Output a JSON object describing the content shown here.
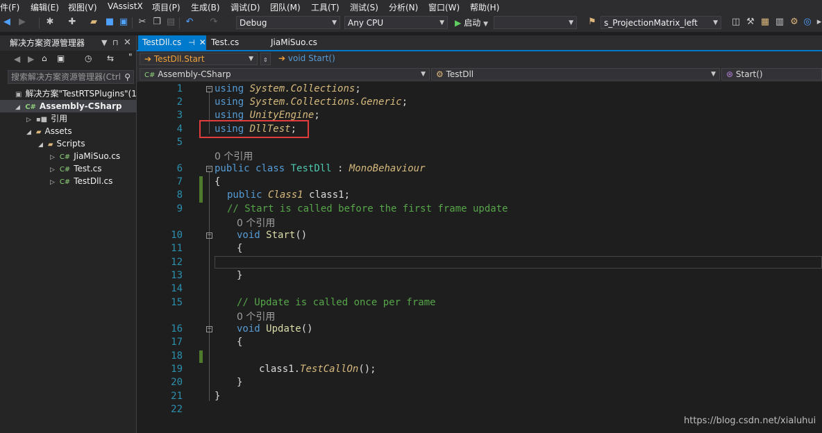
{
  "menu": [
    "件(F)",
    "编辑(E)",
    "视图(V)",
    "VAssistX",
    "项目(P)",
    "生成(B)",
    "调试(D)",
    "团队(M)",
    "工具(T)",
    "测试(S)",
    "分析(N)",
    "窗口(W)",
    "帮助(H)"
  ],
  "toolbar": {
    "config": "Debug",
    "platform": "Any CPU",
    "start_label": "启动",
    "target": "s_ProjectionMatrix_left"
  },
  "solution_explorer": {
    "title": "解决方案资源管理器",
    "search_placeholder": "搜索解决方案资源管理器(Ctrl",
    "tree": [
      {
        "label": "解决方案\"TestRTSPlugins\"(1 ·",
        "icon": "solution-icon"
      },
      {
        "label": "Assembly-CSharp",
        "icon": "csharp-project-icon"
      },
      {
        "label": "引用",
        "icon": "references-icon"
      },
      {
        "label": "Assets",
        "icon": "folder-icon"
      },
      {
        "label": "Scripts",
        "icon": "folder-icon"
      },
      {
        "label": "JiaMiSuo.cs",
        "icon": "csharp-file-icon"
      },
      {
        "label": "Test.cs",
        "icon": "csharp-file-icon"
      },
      {
        "label": "TestDll.cs",
        "icon": "csharp-file-icon"
      }
    ]
  },
  "tabs": [
    {
      "label": "TestDll.cs",
      "active": true
    },
    {
      "label": "Test.cs",
      "active": false
    },
    {
      "label": "JiaMiSuo.cs",
      "active": false
    }
  ],
  "nav": {
    "member_path": "TestDll.Start",
    "member_signature": "void Start()",
    "project": "Assembly-CSharp",
    "class": "TestDll",
    "method": "Start()"
  },
  "code": {
    "line_numbers": [
      "1",
      "2",
      "3",
      "4",
      "5",
      "6",
      "7",
      "8",
      "9",
      "10",
      "11",
      "12",
      "13",
      "14",
      "15",
      "16",
      "17",
      "18",
      "19",
      "20",
      "21",
      "22"
    ],
    "lines": {
      "l1_kw": "using",
      "l1_ns": "System.Collections",
      "l1_end": ";",
      "l2_kw": "using",
      "l2_ns": "System.Collections.Generic",
      "l2_end": ";",
      "l3_kw": "using",
      "l3_ns": "UnityEngine",
      "l3_end": ";",
      "l4_kw": "using",
      "l4_ns": "DllTest",
      "l4_end": ";",
      "ref_class": "0 个引用",
      "l6_kw1": "public",
      "l6_kw2": "class",
      "l6_name": "TestDll",
      "l6_colon": " : ",
      "l6_base": "MonoBehaviour",
      "l7": "{",
      "l8_kw": "public",
      "l8_type": "Class1",
      "l8_rest": " class1;",
      "l9": "// Start is called before the first frame update",
      "ref_start": "0 个引用",
      "l10_kw": "void",
      "l10_name": "Start",
      "l10_rest": "()",
      "l11": "{",
      "l13": "}",
      "l15": "// Update is called once per frame",
      "ref_update": "0 个引用",
      "l16_kw": "void",
      "l16_name": "Update",
      "l16_rest": "()",
      "l17": "{",
      "l19_obj": "class1.",
      "l19_call": "TestCallOn",
      "l19_rest": "();",
      "l20": "}",
      "l21": "}"
    }
  },
  "watermark": "https://blog.csdn.net/xialuhui",
  "colors": {
    "accent": "#007acc",
    "highlight_box": "#e23c3c",
    "keyword": "#569cd6",
    "type": "#d7ba7d",
    "comment": "#57a64a"
  }
}
